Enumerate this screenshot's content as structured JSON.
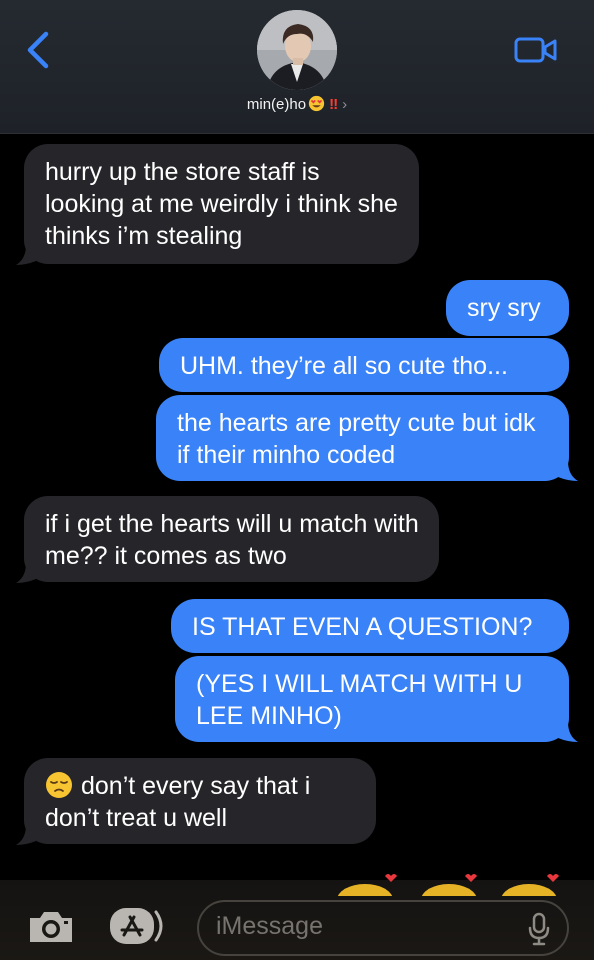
{
  "header": {
    "contact_name": "min(e)ho",
    "contact_bang": "‼",
    "contact_chevron": "›",
    "icons": {
      "back": "chevron-left-icon",
      "video": "video-camera-icon",
      "emoji": "heart-eyes-emoji-icon"
    }
  },
  "messages": [
    {
      "direction": "incoming",
      "text": "hurry up the store staff is looking at me weirdly i think she thinks i’m stealing"
    },
    {
      "direction": "outgoing",
      "text": "sry sry"
    },
    {
      "direction": "outgoing",
      "text": "UHM. they’re all so cute tho..."
    },
    {
      "direction": "outgoing",
      "text": "the hearts are pretty cute but idk if their minho coded"
    },
    {
      "direction": "incoming",
      "text": "if i get the hearts will u match with me?? it comes as two"
    },
    {
      "direction": "outgoing",
      "text": "IS THAT EVEN A QUESTION?"
    },
    {
      "direction": "outgoing",
      "text": "(YES I WILL MATCH WITH U LEE MINHO)"
    },
    {
      "direction": "incoming",
      "text": "don’t every say that i don’t treat u well",
      "emoji": "pensive-face-emoji-icon"
    }
  ],
  "composer": {
    "placeholder": "iMessage",
    "icons": {
      "camera": "camera-icon",
      "apps": "app-store-icon",
      "mic": "microphone-icon"
    }
  },
  "colors": {
    "outgoing": "#3a82f7",
    "incoming": "#26252a",
    "background": "#000000",
    "accent": "#3a82f7"
  }
}
